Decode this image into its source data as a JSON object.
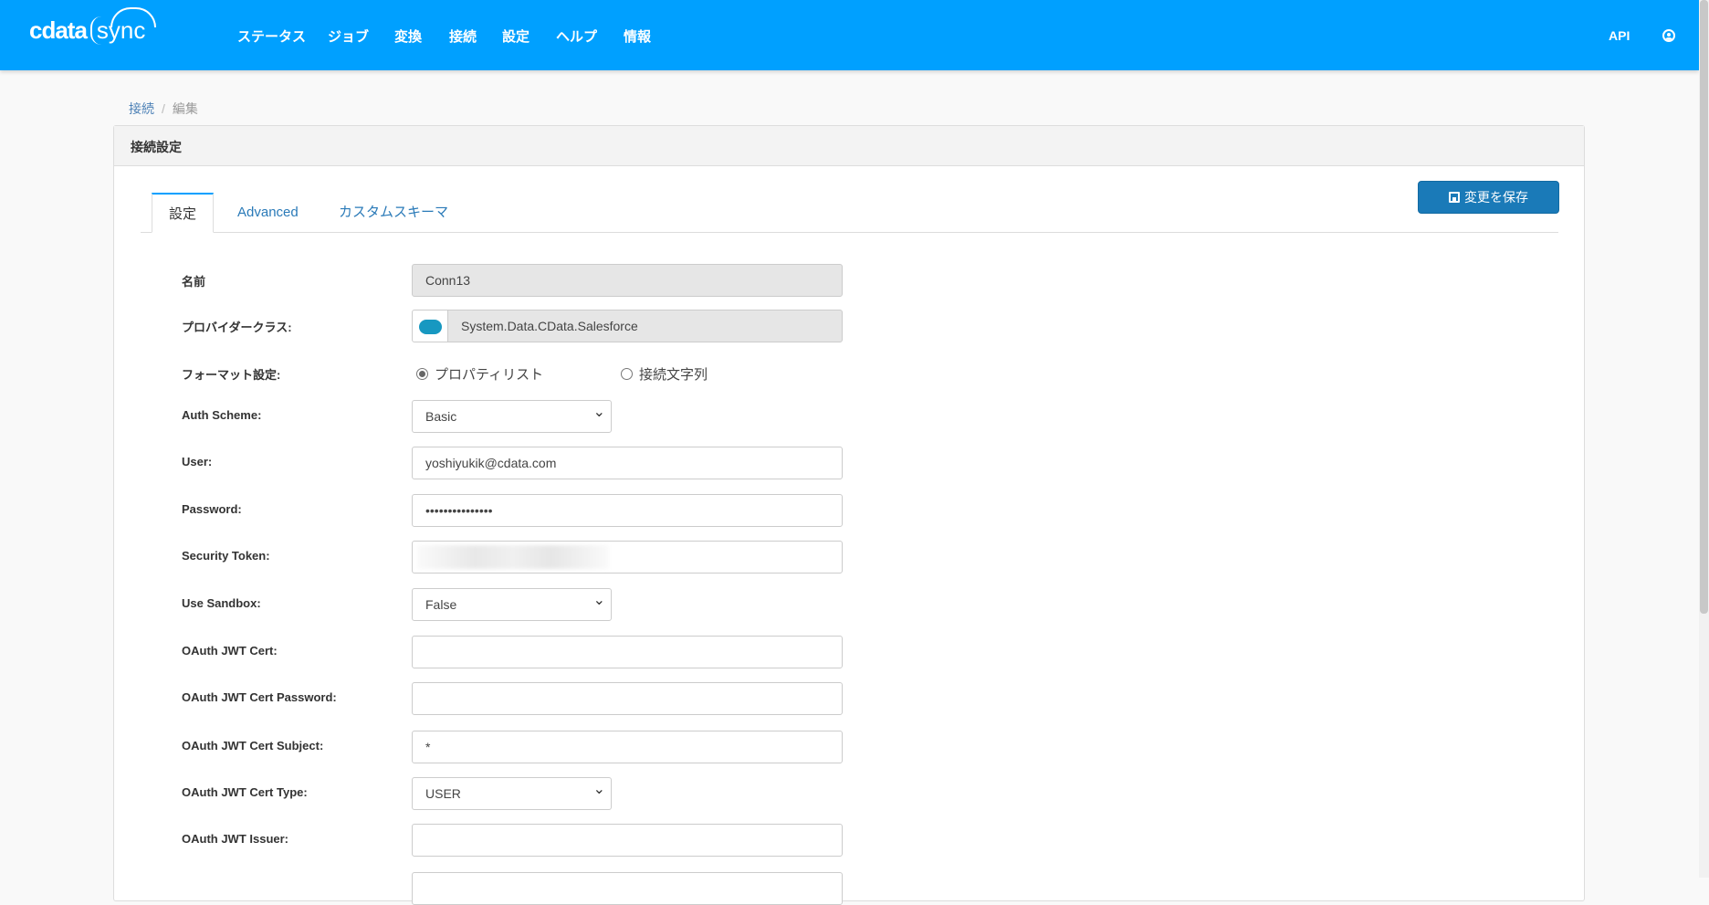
{
  "header": {
    "logo": {
      "brand": "cdata",
      "product": "sync"
    },
    "nav": [
      "ステータス",
      "ジョブ",
      "変換",
      "接続",
      "設定",
      "ヘルプ",
      "情報"
    ],
    "api": "API"
  },
  "breadcrumb": {
    "parent": "接続",
    "separator": "/",
    "current": "編集"
  },
  "card": {
    "title": "接続設定",
    "tabs": [
      "設定",
      "Advanced",
      "カスタムスキーマ"
    ],
    "save_label": "変更を保存"
  },
  "form": {
    "name": {
      "label": "名前",
      "value": "Conn13"
    },
    "provider": {
      "label": "プロバイダークラス:",
      "value": "System.Data.CData.Salesforce",
      "icon": "salesforce-icon"
    },
    "format": {
      "label": "フォーマット設定:",
      "options": [
        "プロパティリスト",
        "接続文字列"
      ],
      "selected": "プロパティリスト"
    },
    "auth_scheme": {
      "label": "Auth Scheme:",
      "value": "Basic"
    },
    "user": {
      "label": "User:",
      "value": "yoshiyukik@cdata.com"
    },
    "password": {
      "label": "Password:",
      "value": "•••••••••••••••"
    },
    "security_token": {
      "label": "Security Token:"
    },
    "use_sandbox": {
      "label": "Use Sandbox:",
      "value": "False"
    },
    "jwt_cert": {
      "label": "OAuth JWT Cert:",
      "value": ""
    },
    "jwt_cert_password": {
      "label": "OAuth JWT Cert Password:",
      "value": ""
    },
    "jwt_cert_subject": {
      "label": "OAuth JWT Cert Subject:",
      "value": "*"
    },
    "jwt_cert_type": {
      "label": "OAuth JWT Cert Type:",
      "value": "USER"
    },
    "jwt_issuer": {
      "label": "OAuth JWT Issuer:",
      "value": ""
    }
  },
  "colors": {
    "header": "#00a0ff",
    "button": "#1a7ab8"
  }
}
